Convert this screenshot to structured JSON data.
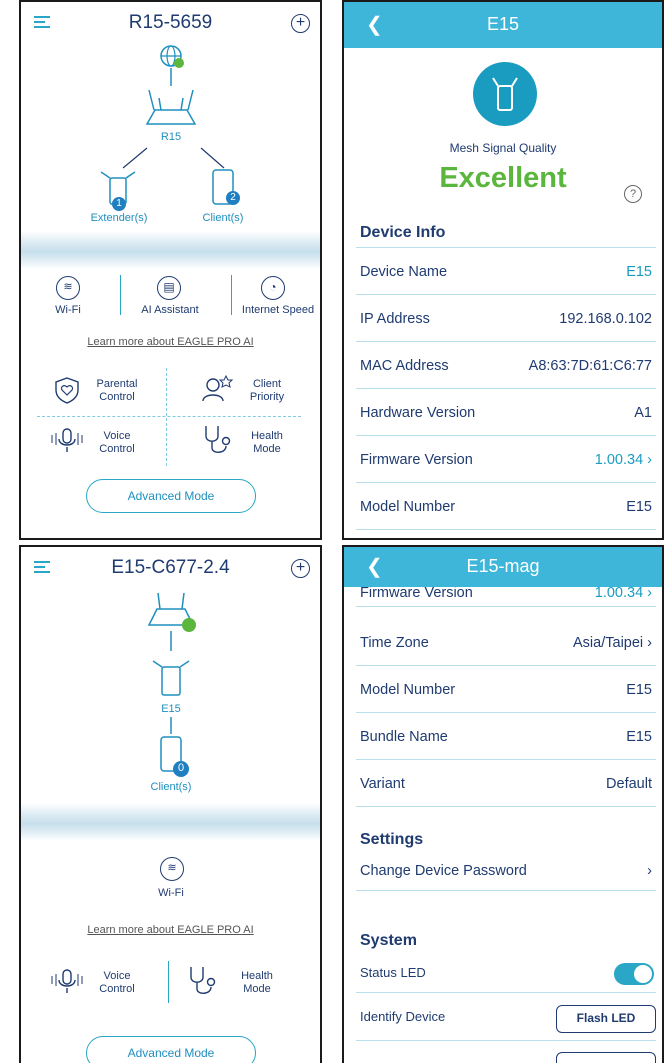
{
  "panel1": {
    "title": "R15-5659",
    "router_label": "R15",
    "extender_label": "Extender(s)",
    "extender_count": "1",
    "client_label": "Client(s)",
    "client_count": "2",
    "features": [
      "Wi-Fi",
      "AI Assistant",
      "Internet Speed"
    ],
    "learn_more": "Learn more about EAGLE PRO AI",
    "grid": [
      {
        "label": "Parental\nControl",
        "icon": "shield-heart-icon"
      },
      {
        "label": "Client\nPriority",
        "icon": "person-star-icon"
      },
      {
        "label": "Voice\nControl",
        "icon": "microphone-icon"
      },
      {
        "label": "Health\nMode",
        "icon": "stethoscope-icon"
      }
    ],
    "advanced": "Advanced Mode"
  },
  "panel2": {
    "title": "E15",
    "quality_label": "Mesh Signal Quality",
    "quality_value": "Excellent",
    "help": "?",
    "section": "Device Info",
    "rows": [
      {
        "key": "Device Name",
        "value": "E15",
        "blue": true,
        "chevron": false
      },
      {
        "key": "IP Address",
        "value": "192.168.0.102",
        "blue": false,
        "chevron": false
      },
      {
        "key": "MAC Address",
        "value": "A8:63:7D:61:C6:77",
        "blue": false,
        "chevron": false
      },
      {
        "key": "Hardware Version",
        "value": "A1",
        "blue": false,
        "chevron": false
      },
      {
        "key": "Firmware Version",
        "value": "1.00.34 ›",
        "blue": true,
        "chevron": true
      },
      {
        "key": "Model Number",
        "value": "E15",
        "blue": false,
        "chevron": false
      }
    ]
  },
  "panel3": {
    "title": "E15-C677-2.4",
    "extender_label": "E15",
    "client_label": "Client(s)",
    "client_count": "0",
    "wifi": "Wi-Fi",
    "learn_more": "Learn more about EAGLE PRO AI",
    "voice": "Voice\nControl",
    "health": "Health\nMode",
    "advanced": "Advanced Mode"
  },
  "panel4": {
    "title": "E15-mag",
    "cut_row_key": "Firmware Version",
    "cut_row_value": "1.00.34 ›",
    "rows": [
      {
        "key": "Time Zone",
        "value": "Asia/Taipei ›"
      },
      {
        "key": "Model Number",
        "value": "E15"
      },
      {
        "key": "Bundle Name",
        "value": "E15"
      },
      {
        "key": "Variant",
        "value": "Default"
      }
    ],
    "settings_section": "Settings",
    "change_password": "Change Device Password",
    "change_password_chevron": "›",
    "system_section": "System",
    "status_led": "Status LED",
    "status_led_on": true,
    "identify_device": "Identify Device",
    "flash_led": "Flash LED"
  },
  "colors": {
    "accent": "#3eb6d9",
    "navy": "#1f3b70",
    "excellent": "#5ab63c",
    "badge": "#1f7fc0"
  }
}
